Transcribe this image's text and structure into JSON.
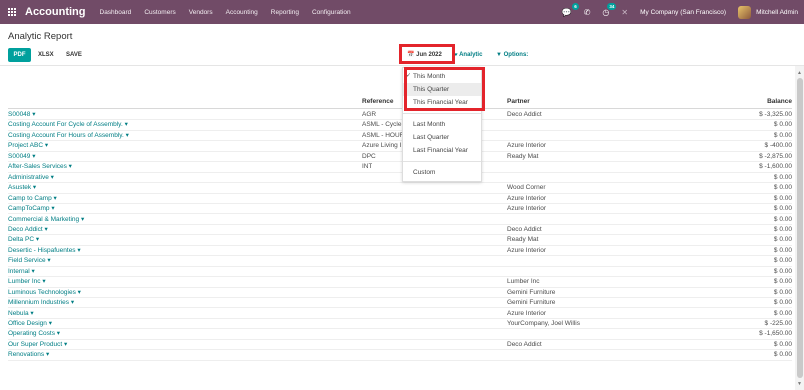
{
  "navbar": {
    "brand": "Accounting",
    "menu": [
      "Dashboard",
      "Customers",
      "Vendors",
      "Accounting",
      "Reporting",
      "Configuration"
    ],
    "chat_badge": "6",
    "activity_badge": "34",
    "company": "My Company (San Francisco)",
    "user": "Mitchell Admin"
  },
  "page": {
    "title": "Analytic Report",
    "buttons": {
      "pdf": "PDF",
      "xlsx": "XLSX",
      "save": "SAVE"
    },
    "filters": {
      "date": "Jun 2022",
      "analytic": "Analytic",
      "options": "Options:"
    }
  },
  "date_dropdown": {
    "group1": [
      "This Month",
      "This Quarter",
      "This Financial Year"
    ],
    "group2": [
      "Last Month",
      "Last Quarter",
      "Last Financial Year"
    ],
    "group3": [
      "Custom"
    ],
    "selected": "This Month"
  },
  "table": {
    "headers": {
      "reference": "Reference",
      "partner": "Partner",
      "balance": "Balance"
    },
    "rows": [
      {
        "name": "S00048 ▾",
        "ref": "AGR",
        "partner": "Deco Addict",
        "balance": "$ -3,325.00"
      },
      {
        "name": "Costing Account For Cycle of Assembly. ▾",
        "ref": "ASML - Cycle",
        "partner": "",
        "balance": "$ 0.00"
      },
      {
        "name": "Costing Account For Hours of Assembly. ▾",
        "ref": "ASML - HOUR",
        "partner": "",
        "balance": "$ 0.00"
      },
      {
        "name": "Project ABC ▾",
        "ref": "Azure Living I",
        "partner": "Azure Interior",
        "balance": "$ -400.00"
      },
      {
        "name": "S00049 ▾",
        "ref": "DPC",
        "partner": "Ready Mat",
        "balance": "$ -2,875.00"
      },
      {
        "name": "After-Sales Services ▾",
        "ref": "INT",
        "partner": "",
        "balance": "$ -1,600.00"
      },
      {
        "name": "Administrative ▾",
        "ref": "",
        "partner": "",
        "balance": "$ 0.00"
      },
      {
        "name": "Asustek ▾",
        "ref": "",
        "partner": "Wood Corner",
        "balance": "$ 0.00"
      },
      {
        "name": "Camp to Camp ▾",
        "ref": "",
        "partner": "Azure Interior",
        "balance": "$ 0.00"
      },
      {
        "name": "CampToCamp ▾",
        "ref": "",
        "partner": "Azure Interior",
        "balance": "$ 0.00"
      },
      {
        "name": "Commercial & Marketing ▾",
        "ref": "",
        "partner": "",
        "balance": "$ 0.00"
      },
      {
        "name": "Deco Addict ▾",
        "ref": "",
        "partner": "Deco Addict",
        "balance": "$ 0.00"
      },
      {
        "name": "Delta PC ▾",
        "ref": "",
        "partner": "Ready Mat",
        "balance": "$ 0.00"
      },
      {
        "name": "Desertic - Hispafuentes ▾",
        "ref": "",
        "partner": "Azure Interior",
        "balance": "$ 0.00"
      },
      {
        "name": "Field Service ▾",
        "ref": "",
        "partner": "",
        "balance": "$ 0.00"
      },
      {
        "name": "Internal ▾",
        "ref": "",
        "partner": "",
        "balance": "$ 0.00"
      },
      {
        "name": "Lumber Inc ▾",
        "ref": "",
        "partner": "Lumber Inc",
        "balance": "$ 0.00"
      },
      {
        "name": "Luminous Technologies ▾",
        "ref": "",
        "partner": "Gemini Furniture",
        "balance": "$ 0.00"
      },
      {
        "name": "Millennium Industries ▾",
        "ref": "",
        "partner": "Gemini Furniture",
        "balance": "$ 0.00"
      },
      {
        "name": "Nebula ▾",
        "ref": "",
        "partner": "Azure Interior",
        "balance": "$ 0.00"
      },
      {
        "name": "Office Design ▾",
        "ref": "",
        "partner": "YourCompany, Joel Willis",
        "balance": "$ -225.00"
      },
      {
        "name": "Operating Costs ▾",
        "ref": "",
        "partner": "",
        "balance": "$ -1,650.00"
      },
      {
        "name": "Our Super Product ▾",
        "ref": "",
        "partner": "Deco Addict",
        "balance": "$ 0.00"
      },
      {
        "name": "Renovations ▾",
        "ref": "",
        "partner": "",
        "balance": "$ 0.00"
      }
    ]
  },
  "colors": {
    "navbar": "#714b67",
    "accent": "#00a09d",
    "link": "#017e84",
    "highlight": "#e3242b"
  }
}
